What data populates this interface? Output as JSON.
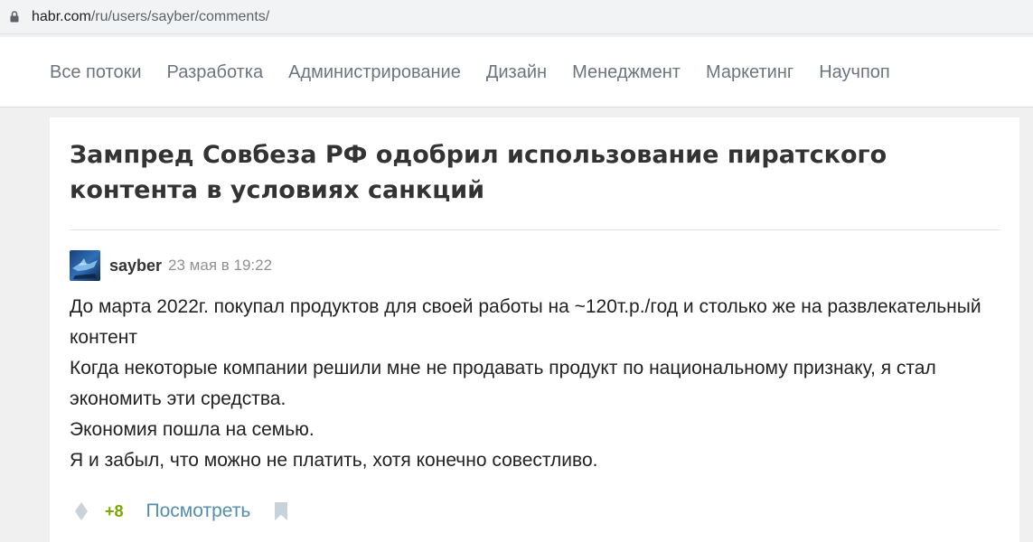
{
  "browser": {
    "url_host": "habr.com",
    "url_path": "/ru/users/sayber/comments/"
  },
  "nav": {
    "items": [
      {
        "label": "Все потоки"
      },
      {
        "label": "Разработка"
      },
      {
        "label": "Администрирование"
      },
      {
        "label": "Дизайн"
      },
      {
        "label": "Менеджмент"
      },
      {
        "label": "Маркетинг"
      },
      {
        "label": "Научпоп"
      }
    ]
  },
  "article": {
    "title": "Зампред Совбеза РФ одобрил использование пиратского контента в условиях санкций"
  },
  "comment": {
    "username": "sayber",
    "timestamp": "23 мая в 19:22",
    "lines": [
      "До марта 2022г. покупал продуктов для своей работы на ~120т.р./год и столько же на развлекательный контент",
      "Когда некоторые компании решили мне не продавать продукт по национальному признаку, я стал экономить эти средства.",
      "Экономия пошла на семью.",
      "Я и забыл, что можно не платить, хотя конечно совестливо."
    ],
    "score": "+8",
    "view_label": "Посмотреть"
  },
  "icons": {
    "lock": "lock-icon",
    "avatar": "avatar-image",
    "vote": "vote-diamond-icon",
    "bookmark": "bookmark-icon"
  },
  "colors": {
    "score": "#7aa600",
    "link": "#548eaa",
    "nav_text": "#6c757d",
    "title": "#333333"
  }
}
